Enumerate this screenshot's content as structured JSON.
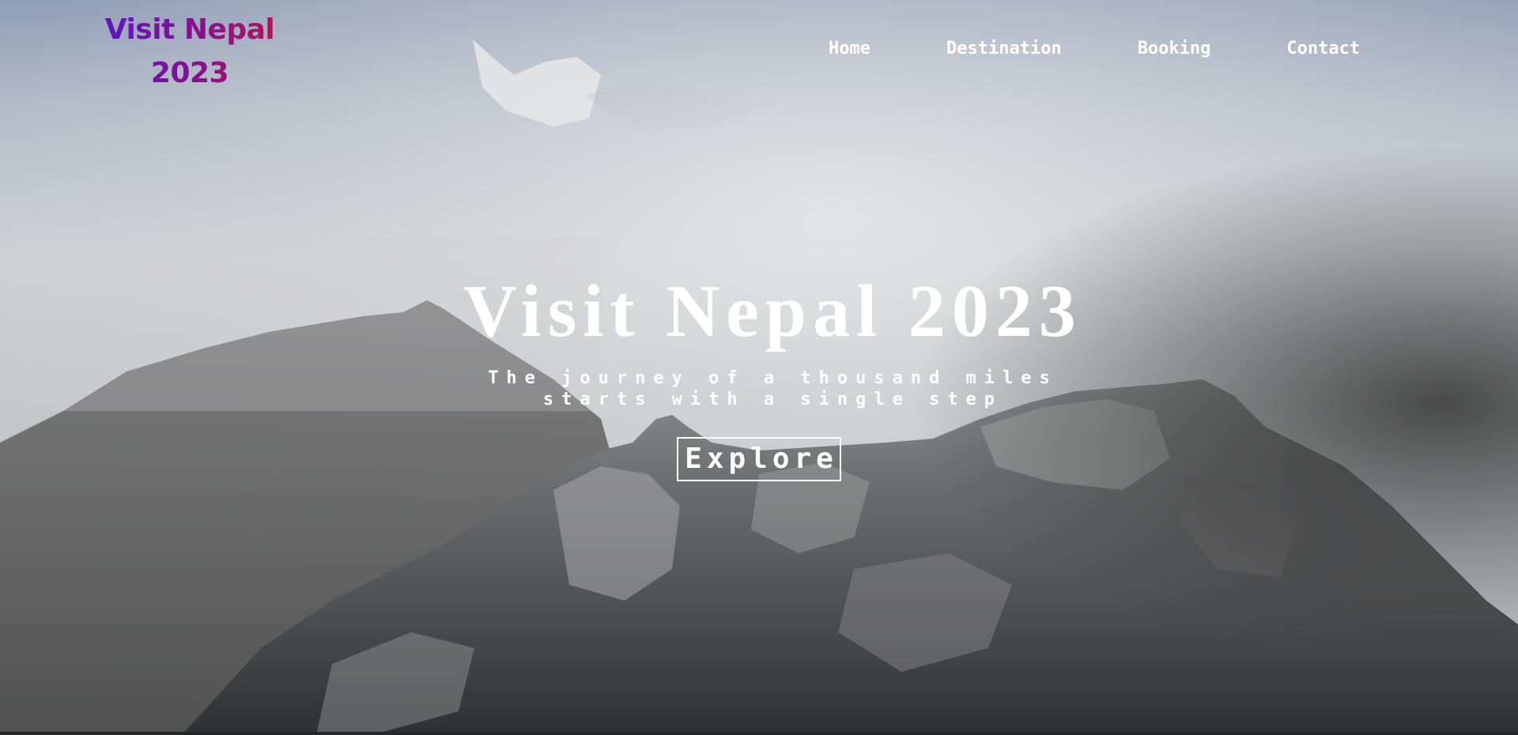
{
  "brand": {
    "line1": "Visit Nepal",
    "line2": "2023"
  },
  "nav": {
    "items": [
      {
        "label": "Home"
      },
      {
        "label": "Destination"
      },
      {
        "label": "Booking"
      },
      {
        "label": "Contact"
      }
    ]
  },
  "hero": {
    "title": "Visit Nepal 2023",
    "subtitle_line1": "The journey of a thousand miles",
    "subtitle_line2": "starts with a single step",
    "cta_label": "Explore"
  },
  "colors": {
    "brand_gradient_start": "#5a16c8",
    "brand_gradient_end": "#b8135a",
    "text_primary": "#ffffff"
  }
}
